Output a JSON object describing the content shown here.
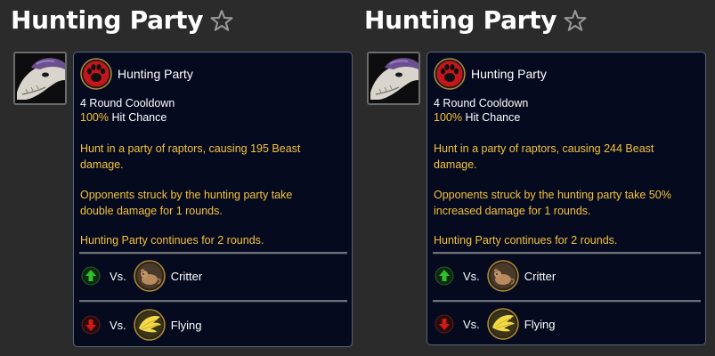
{
  "panels": [
    {
      "title": "Hunting Party",
      "ability": {
        "name": "Hunting Party",
        "cooldown": "4 Round Cooldown",
        "hit_pct": "100%",
        "hit_label": "Hit Chance",
        "desc1a": "Hunt in a party of raptors, causing 195 Beast",
        "desc1b": "damage.",
        "desc2a": "Opponents struck by the hunting party take",
        "desc2b": "double damage for 1 rounds.",
        "desc3": "Hunting Party continues for 2 rounds."
      },
      "matchups": [
        {
          "vs": "Vs.",
          "family": "Critter",
          "direction": "strong",
          "family_icon": "critter-icon",
          "arrow_icon": "up-arrow-icon"
        },
        {
          "vs": "Vs.",
          "family": "Flying",
          "direction": "weak",
          "family_icon": "flying-icon",
          "arrow_icon": "down-arrow-icon"
        }
      ]
    },
    {
      "title": "Hunting Party",
      "ability": {
        "name": "Hunting Party",
        "cooldown": "4 Round Cooldown",
        "hit_pct": "100%",
        "hit_label": "Hit Chance",
        "desc1a": "Hunt in a party of raptors, causing 244 Beast",
        "desc1b": "damage.",
        "desc2a": "Opponents struck by the hunting party take 50%",
        "desc2b": "increased damage for 1 rounds.",
        "desc3": "Hunting Party continues for 2 rounds."
      },
      "matchups": [
        {
          "vs": "Vs.",
          "family": "Critter",
          "direction": "strong",
          "family_icon": "critter-icon",
          "arrow_icon": "up-arrow-icon"
        },
        {
          "vs": "Vs.",
          "family": "Flying",
          "direction": "weak",
          "family_icon": "flying-icon",
          "arrow_icon": "down-arrow-icon"
        }
      ]
    }
  ],
  "icons": {
    "favorite": "star-outline-icon",
    "portrait": "raptor-portrait-icon",
    "ability": "paw-icon"
  },
  "colors": {
    "background": "#2b2b2b",
    "card_bg": "#050a1f",
    "gold_text": "#f3c33a",
    "strong_arrow": "#1f9a1f",
    "weak_arrow": "#b01414",
    "paw_red": "#c4161c"
  }
}
